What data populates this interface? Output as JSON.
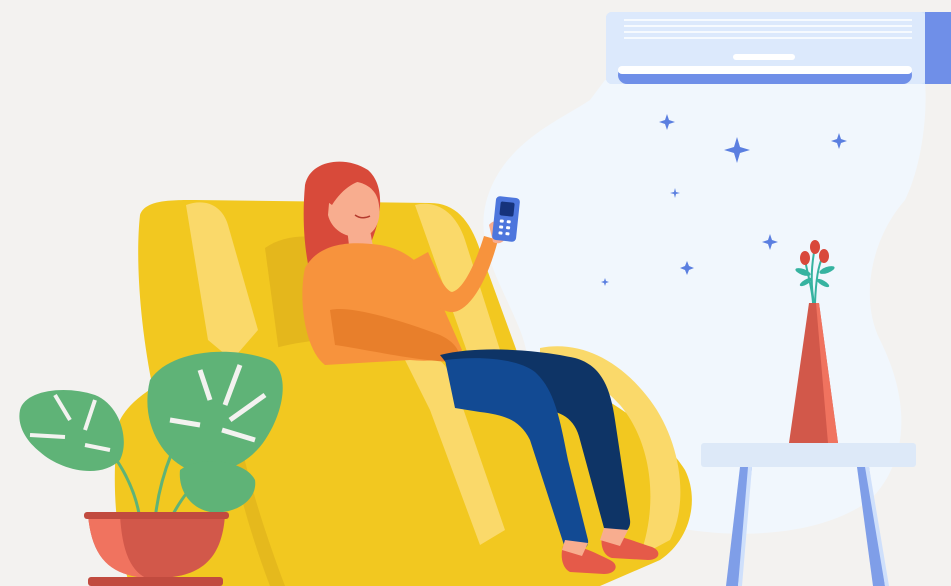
{
  "scene": {
    "subject": "woman-relaxing-in-armchair-with-ac-remote",
    "colors": {
      "background": "#f3f2f0",
      "cool_air": "#f1f7fd",
      "ac_body": "#cfe2fb",
      "ac_accent": "#6f8fe8",
      "ac_slot": "#ffffff",
      "snowflake": "#5b7fe0",
      "chair": "#f2c820",
      "chair_light": "#fad96a",
      "chair_shadow": "#d8a91a",
      "sweater": "#f7933d",
      "sweater_shadow": "#e87f2b",
      "skin": "#f8ad8f",
      "hair": "#d84a3a",
      "jeans": "#124a93",
      "jeans_dark": "#0e3466",
      "shoes": "#e55a49",
      "remote": "#4d76dd",
      "leaf": "#5fb377",
      "pot": "#d2584a",
      "pot_light": "#f0735f",
      "vase": "#d2584a",
      "flowers": "#d9483b",
      "flower_leaves": "#36b3a0",
      "table_top": "#dde9f8",
      "table_legs": "#7f9ee8"
    },
    "icons": {
      "air_conditioner": "air-conditioner-icon",
      "remote": "remote-control-icon",
      "snowflake": "snowflake-icon",
      "plant": "monstera-plant-icon",
      "vase": "flower-vase-icon",
      "table": "side-table-icon"
    }
  }
}
